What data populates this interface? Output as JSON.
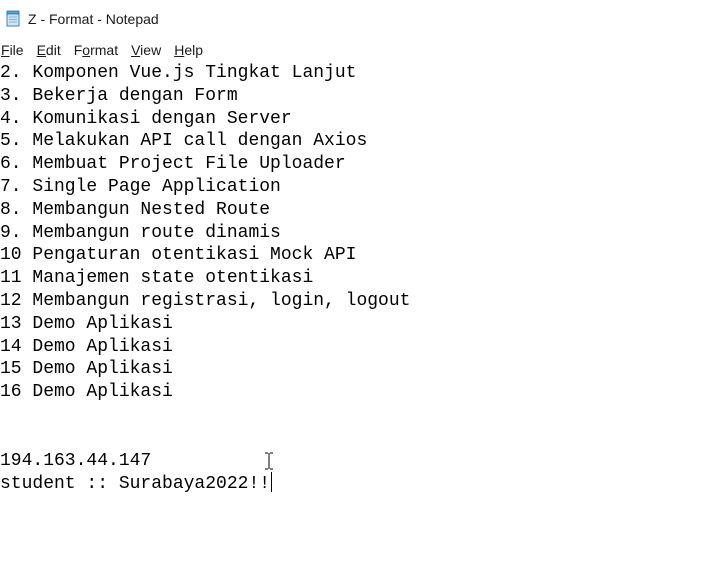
{
  "window": {
    "title": "Z - Format - Notepad",
    "app_icon": "notepad-icon"
  },
  "menubar": {
    "items": [
      {
        "label": "File",
        "mnemonic": "F",
        "rest": "ile"
      },
      {
        "label": "Edit",
        "mnemonic": "E",
        "rest": "dit"
      },
      {
        "label": "Format",
        "before": "F",
        "mnemonic": "o",
        "rest": "rmat"
      },
      {
        "label": "View",
        "mnemonic": "V",
        "rest": "iew"
      },
      {
        "label": "Help",
        "mnemonic": "H",
        "rest": "elp"
      }
    ]
  },
  "editor": {
    "lines": [
      "2. Komponen Vue.js Tingkat Lanjut",
      "3. Bekerja dengan Form",
      "4. Komunikasi dengan Server",
      "5. Melakukan API call dengan Axios",
      "6. Membuat Project File Uploader",
      "7. Single Page Application",
      "8. Membangun Nested Route",
      "9. Membangun route dinamis",
      "10 Pengaturan otentikasi Mock API",
      "11 Manajemen state otentikasi",
      "12 Membangun registrasi, login, logout",
      "13 Demo Aplikasi",
      "14 Demo Aplikasi",
      "15 Demo Aplikasi",
      "16 Demo Aplikasi",
      "",
      "",
      "194.163.44.147",
      "student :: Surabaya2022!!"
    ]
  },
  "cursor": {
    "icon": "text-ibeam-cursor-icon"
  }
}
